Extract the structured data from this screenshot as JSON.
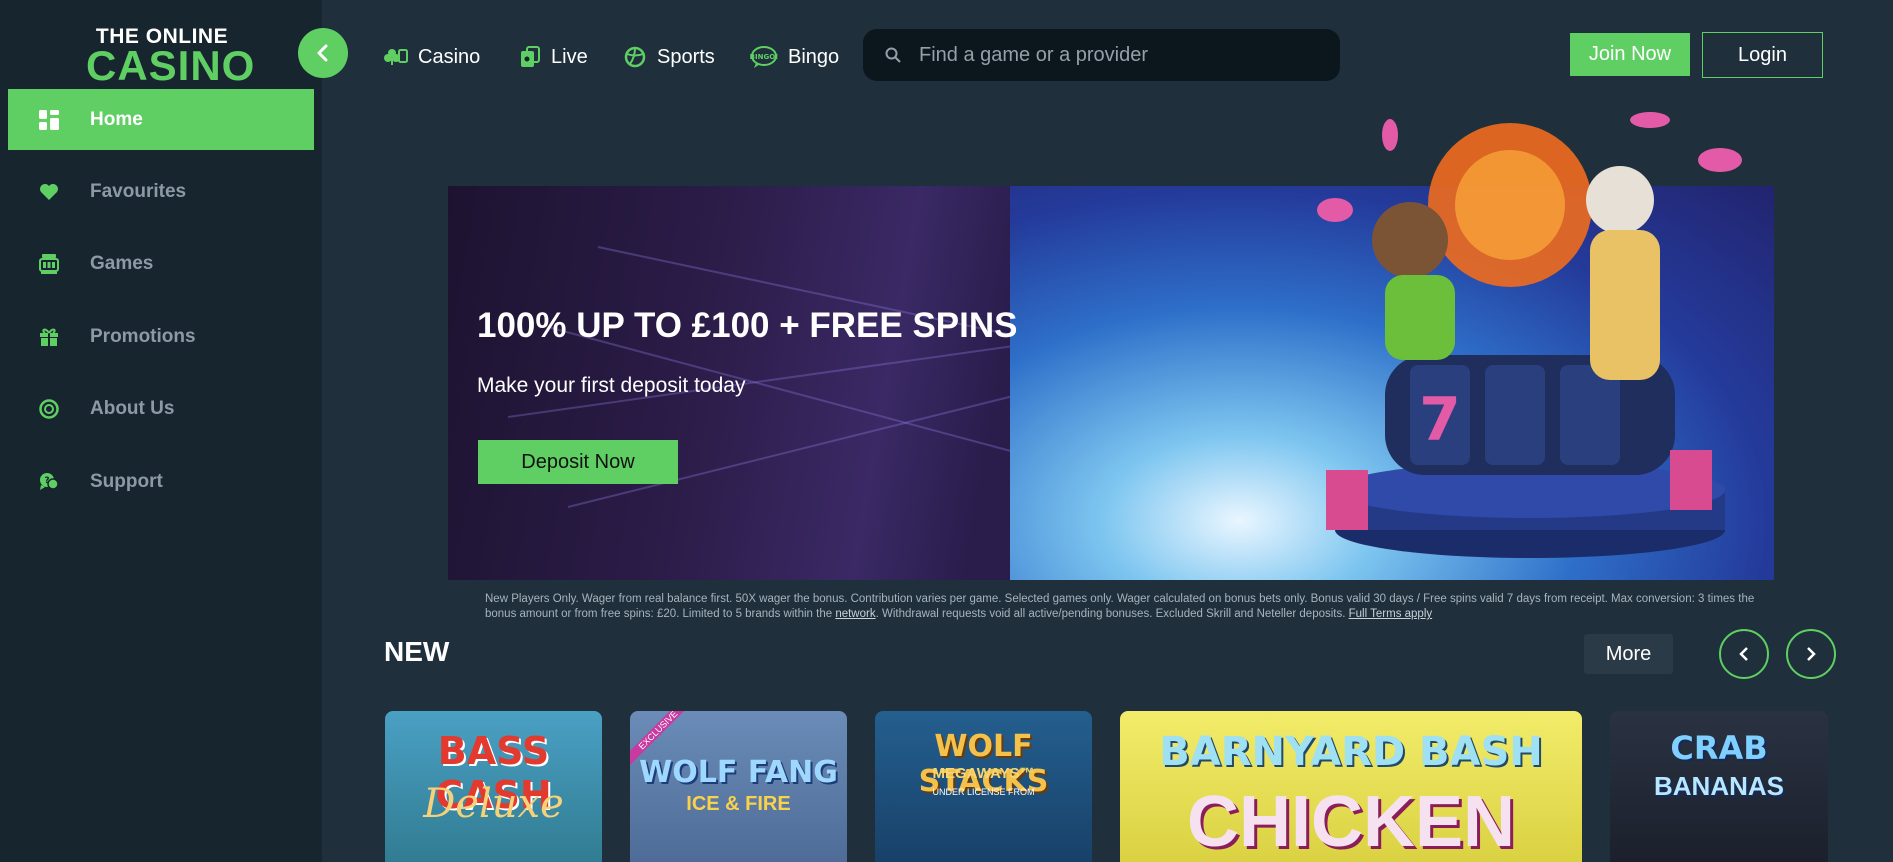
{
  "logo": {
    "line1": "THE ONLINE",
    "line2": "CASINO"
  },
  "sidebar": {
    "items": [
      {
        "label": "Home",
        "icon": "home-grid-icon",
        "active": true
      },
      {
        "label": "Favourites",
        "icon": "heart-icon"
      },
      {
        "label": "Games",
        "icon": "slot-machine-icon"
      },
      {
        "label": "Promotions",
        "icon": "gift-icon"
      },
      {
        "label": "About Us",
        "icon": "chip-icon"
      },
      {
        "label": "Support",
        "icon": "chat-bubbles-icon"
      }
    ]
  },
  "topnav": {
    "items": [
      {
        "label": "Casino",
        "icon": "cards-clubs-icon"
      },
      {
        "label": "Live",
        "icon": "live-cards-icon"
      },
      {
        "label": "Sports",
        "icon": "ball-icon"
      },
      {
        "label": "Bingo",
        "icon": "bingo-badge-icon"
      }
    ],
    "bingo_badge_text": "BINGO!"
  },
  "search": {
    "placeholder": "Find a game or a provider"
  },
  "header": {
    "join_label": "Join Now",
    "login_label": "Login"
  },
  "banner": {
    "title": "100% UP TO £100 + FREE SPINS",
    "subtitle": "Make your first deposit today",
    "cta_label": "Deposit Now",
    "reel_digit": "7"
  },
  "terms": {
    "text_part1": "New Players Only. Wager from real balance first. 50X wager the bonus. Contribution varies per game. Selected games only. Wager calculated on bonus bets only. Bonus valid 30 days / Free spins valid 7 days from receipt. Max conversion: 3 times the bonus amount or from free spins: £20. Limited to 5 brands within the ",
    "network_link": "network",
    "text_part2": ". Withdrawal requests void all active/pending bonuses. Excluded Skrill and Neteller deposits. ",
    "full_terms_link": "Full Terms apply"
  },
  "new_section": {
    "title": "NEW",
    "more_label": "More",
    "games": [
      {
        "name": "BASS CASH",
        "subtitle": "Deluxe",
        "color": "#3a86a8"
      },
      {
        "name": "WOLF FANG",
        "subtitle": "ICE & FIRE",
        "ribbon": "EXCLUSIVE",
        "color": "#4a6a95"
      },
      {
        "name": "WOLF STACKS",
        "subtitle": "MEGAWAYS™",
        "footnote": "UNDER LICENSE FROM",
        "color": "#1f5a8a"
      },
      {
        "name": "BARNYARD BASH",
        "subtitle": "CHICKEN",
        "color": "#e9e35a"
      },
      {
        "name": "CRAB",
        "subtitle": "BANANAS",
        "color": "#1e2430"
      }
    ]
  },
  "colors": {
    "accent": "#5fcf63",
    "background": "#1f2f3c",
    "sidebar": "#17252f"
  }
}
